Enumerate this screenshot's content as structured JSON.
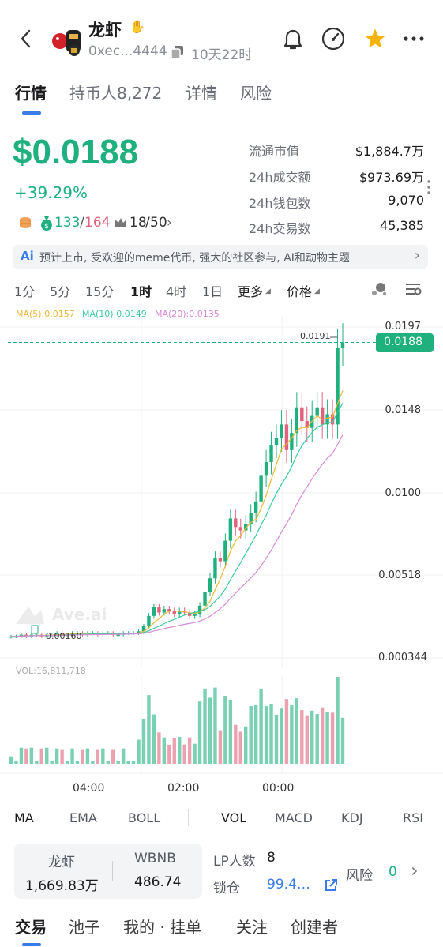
{
  "header": {
    "name": "龙虾",
    "address": "0xec...4444",
    "age": "10天22时"
  },
  "tabs": [
    {
      "label": "行情",
      "active": true
    },
    {
      "label": "持币人8,272",
      "active": false
    },
    {
      "label": "详情",
      "active": false
    },
    {
      "label": "风险",
      "active": false
    }
  ],
  "price": {
    "value": "$0.0188",
    "change": "+39.29%",
    "holders_current": "133",
    "holders_total": "164",
    "rank_current": "18",
    "rank_total": "50"
  },
  "stats": [
    {
      "label": "流通市值",
      "value": "$1,884.7万"
    },
    {
      "label": "24h成交额",
      "value": "$973.69万"
    },
    {
      "label": "24h钱包数",
      "value": "9,070"
    },
    {
      "label": "24h交易数",
      "value": "45,385"
    }
  ],
  "ai_banner": {
    "badge": "Ai",
    "text": "预计上市, 受欢迎的meme代币, 强大的社区参与, AI和动物主题"
  },
  "timeframes": [
    "1分",
    "5分",
    "15分",
    "1时",
    "4时",
    "1日"
  ],
  "timeframe_active": "1时",
  "more_label": "更多",
  "price_label": "价格",
  "ma_legend": {
    "ma5": "MA(5):0.0157",
    "ma10": "MA(10):0.0149",
    "ma20": "MA(20):0.0135"
  },
  "chart_labels": {
    "y_top": "0.0197",
    "current_price": "0.0188",
    "y_2": "0.0148",
    "y_3": "0.0100",
    "y_4": "0.00518",
    "y_bottom": "0.000344",
    "high_marker": "0.0191",
    "low_marker": "0.00160",
    "watermark": "Ave.ai",
    "vol": "VOL:16,811,718"
  },
  "x_labels": [
    "04:00",
    "02:00",
    "00:00"
  ],
  "indicators": [
    "MA",
    "EMA",
    "BOLL",
    "VOL",
    "MACD",
    "KDJ",
    "RSI"
  ],
  "pool": {
    "token1_name": "龙虾",
    "token1_amount": "1,669.83万",
    "token2_name": "WBNB",
    "token2_amount": "486.74",
    "lp_label": "LP人数",
    "lp_value": "8",
    "lock_label": "锁仓",
    "lock_value": "99.4…",
    "risk_label": "风险",
    "risk_value": "0"
  },
  "bottom_tabs": [
    "交易",
    "池子",
    "我的 · 挂单",
    "关注",
    "创建者"
  ],
  "colors": {
    "up": "#1fb07e",
    "down": "#e0627b",
    "accent": "#3b7ce8",
    "star": "#f6b400"
  },
  "chart_data": {
    "type": "line",
    "y_ticks": [
      "0.0197",
      "0.0148",
      "0.0100",
      "0.00518",
      "0.000344"
    ],
    "x_ticks": [
      "04:00",
      "02:00",
      "00:00"
    ],
    "current_price": 0.0188,
    "high": 0.0191,
    "low": 0.0016,
    "series": [
      {
        "name": "MA(5)",
        "last": 0.0157
      },
      {
        "name": "MA(10)",
        "last": 0.0149
      },
      {
        "name": "MA(20)",
        "last": 0.0135
      }
    ],
    "close_approx": [
      0.0016,
      0.0016,
      0.0017,
      0.0016,
      0.0017,
      0.0017,
      0.0016,
      0.0017,
      0.0017,
      0.0018,
      0.0017,
      0.0017,
      0.0018,
      0.0018,
      0.0017,
      0.0018,
      0.0018,
      0.0017,
      0.0018,
      0.0018,
      0.0017,
      0.0017,
      0.0018,
      0.0018,
      0.0018,
      0.0019,
      0.0022,
      0.0028,
      0.0033,
      0.003,
      0.0032,
      0.0031,
      0.0029,
      0.0031,
      0.003,
      0.0028,
      0.0029,
      0.0034,
      0.0042,
      0.005,
      0.0062,
      0.006,
      0.0072,
      0.0085,
      0.008,
      0.0078,
      0.0082,
      0.0088,
      0.0095,
      0.011,
      0.0118,
      0.0128,
      0.0132,
      0.014,
      0.0125,
      0.0135,
      0.015,
      0.0142,
      0.0138,
      0.0145,
      0.015,
      0.014,
      0.0146,
      0.014,
      0.0185,
      0.0188
    ]
  }
}
